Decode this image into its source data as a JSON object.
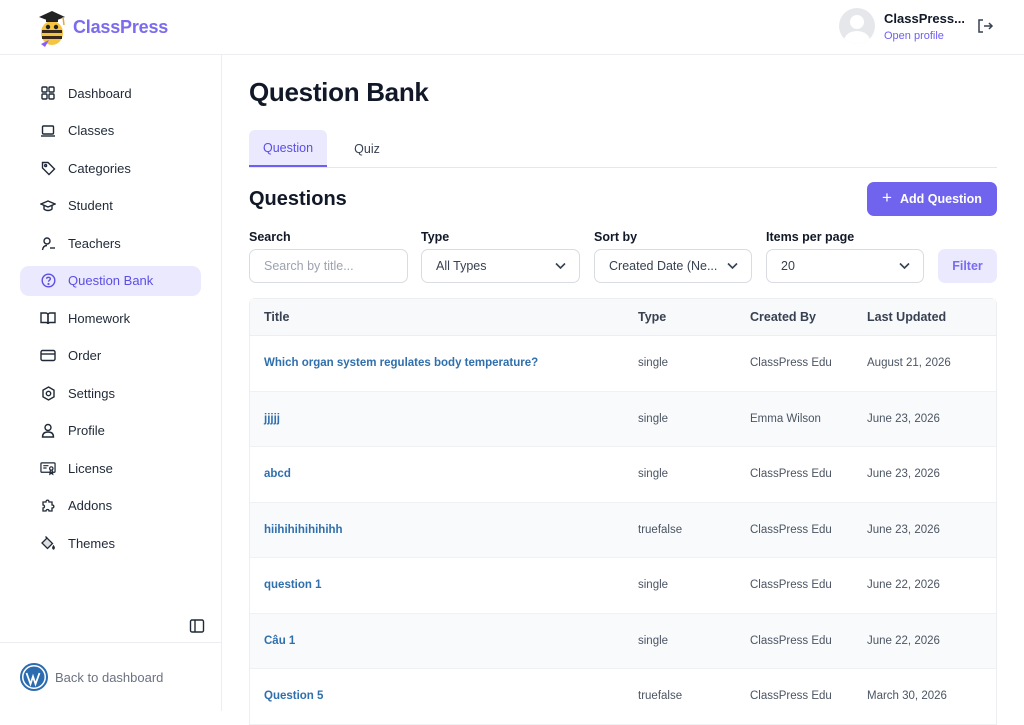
{
  "header": {
    "app_name": "ClassPress",
    "user_name": "ClassPress...",
    "profile_link": "Open profile"
  },
  "sidebar": {
    "items": [
      {
        "label": "Dashboard",
        "icon": "grid-icon",
        "active": false
      },
      {
        "label": "Classes",
        "icon": "laptop-icon",
        "active": false
      },
      {
        "label": "Categories",
        "icon": "tag-icon",
        "active": false
      },
      {
        "label": "Student",
        "icon": "graduation-cap-icon",
        "active": false
      },
      {
        "label": "Teachers",
        "icon": "teacher-icon",
        "active": false
      },
      {
        "label": "Question Bank",
        "icon": "question-circle-icon",
        "active": true
      },
      {
        "label": "Homework",
        "icon": "book-icon",
        "active": false
      },
      {
        "label": "Order",
        "icon": "credit-card-icon",
        "active": false
      },
      {
        "label": "Settings",
        "icon": "gear-icon",
        "active": false
      },
      {
        "label": "Profile",
        "icon": "user-icon",
        "active": false
      },
      {
        "label": "License",
        "icon": "license-icon",
        "active": false
      },
      {
        "label": "Addons",
        "icon": "puzzle-icon",
        "active": false
      },
      {
        "label": "Themes",
        "icon": "paint-bucket-icon",
        "active": false
      }
    ],
    "back_label": "Back to dashboard"
  },
  "main": {
    "title": "Question Bank",
    "tabs": [
      {
        "label": "Question",
        "active": true
      },
      {
        "label": "Quiz",
        "active": false
      }
    ],
    "section_title": "Questions",
    "add_button": "Add Question",
    "filters": {
      "search_label": "Search",
      "search_placeholder": "Search by title...",
      "type_label": "Type",
      "type_value": "All Types",
      "sort_label": "Sort by",
      "sort_value": "Created Date (Ne...",
      "per_page_label": "Items per page",
      "per_page_value": "20",
      "filter_button": "Filter"
    },
    "table": {
      "headers": [
        "Title",
        "Type",
        "Created By",
        "Last Updated"
      ],
      "rows": [
        {
          "title": "Which organ system regulates body temperature?",
          "type": "single",
          "created_by": "ClassPress Edu",
          "updated": "August 21, 2026"
        },
        {
          "title": "jjjjj",
          "type": "single",
          "created_by": "Emma Wilson",
          "updated": "June 23, 2026"
        },
        {
          "title": "abcd",
          "type": "single",
          "created_by": "ClassPress Edu",
          "updated": "June 23, 2026"
        },
        {
          "title": "hiihihihihihihh",
          "type": "truefalse",
          "created_by": "ClassPress Edu",
          "updated": "June 23, 2026"
        },
        {
          "title": "question 1",
          "type": "single",
          "created_by": "ClassPress Edu",
          "updated": "June 22, 2026"
        },
        {
          "title": "Câu 1",
          "type": "single",
          "created_by": "ClassPress Edu",
          "updated": "June 22, 2026"
        },
        {
          "title": "Question 5",
          "type": "truefalse",
          "created_by": "ClassPress Edu",
          "updated": "March 30, 2026"
        }
      ]
    }
  },
  "colors": {
    "accent": "#7064ee",
    "accent_light": "#ebe9fd",
    "link": "#2f6fad"
  }
}
